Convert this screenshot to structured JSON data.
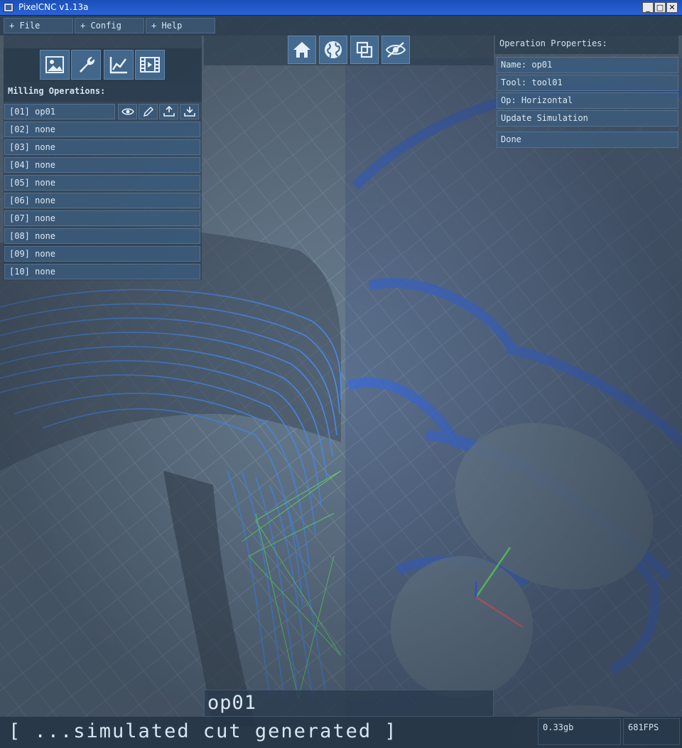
{
  "window": {
    "title": "PixelCNC v1.13a"
  },
  "menu": [
    {
      "label": "+ File"
    },
    {
      "label": "+ Config"
    },
    {
      "label": "+ Help"
    }
  ],
  "toolbar_icons": [
    "image-icon",
    "wrench-icon",
    "chart-icon",
    "film-icon"
  ],
  "milling": {
    "title": "Milling Operations:",
    "operations": [
      {
        "label": "[01] op01"
      },
      {
        "label": "[02] none"
      },
      {
        "label": "[03] none"
      },
      {
        "label": "[04] none"
      },
      {
        "label": "[05] none"
      },
      {
        "label": "[06] none"
      },
      {
        "label": "[07] none"
      },
      {
        "label": "[08] none"
      },
      {
        "label": "[09] none"
      },
      {
        "label": "[10] none"
      }
    ],
    "row_icons": [
      "eye-icon",
      "edit-icon",
      "export-icon",
      "download-icon"
    ]
  },
  "view_icons": [
    "home-icon",
    "globe-icon",
    "copy-icon",
    "hide-icon"
  ],
  "properties": {
    "title": "Operation Properties:",
    "name": "Name: op01",
    "tool": "Tool: tool01",
    "op": "Op: Horizontal",
    "update": "Update Simulation",
    "done": "Done"
  },
  "bottom": {
    "current_op": "op01",
    "status": "[ ...simulated cut generated ]",
    "memory": "0.33gb",
    "fps": "681FPS"
  },
  "colors": {
    "toolpath": "#3f8cff",
    "grid": "#9fb8cc",
    "panel": "#3c5c7c",
    "axis_x": "#ff6070",
    "axis_y": "#6aff6a",
    "axis_z": "#4060ff"
  }
}
